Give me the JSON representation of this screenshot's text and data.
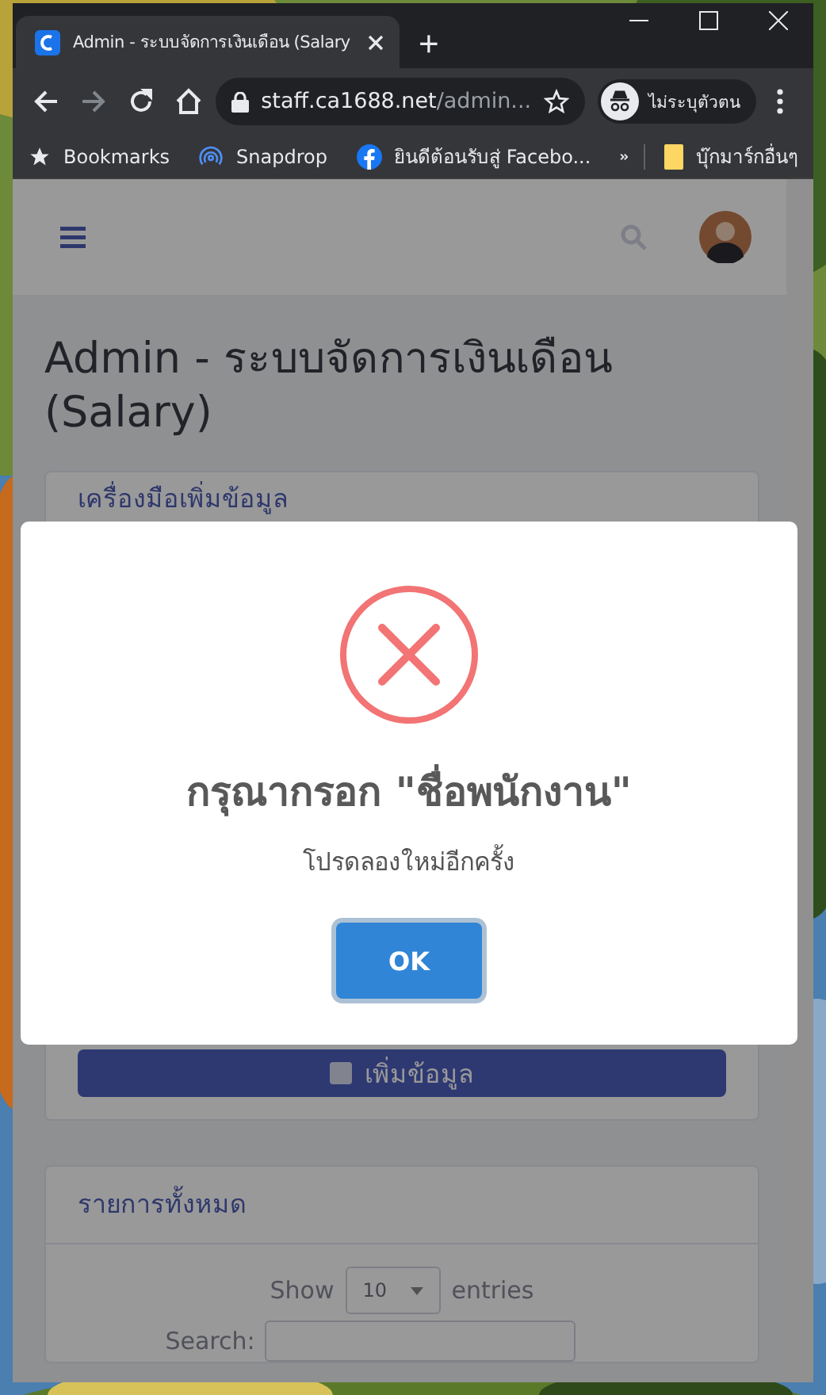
{
  "browser": {
    "tab": {
      "title": "Admin - ระบบจัดการเงินเดือน (Salary",
      "selected": true
    },
    "new_tab": "+",
    "address": {
      "host": "staff.ca1688.net",
      "path": "/admin..."
    },
    "profile": "ไม่ระบุตัวตน",
    "bookmarks": [
      {
        "label": "Bookmarks",
        "kind": "star"
      },
      {
        "label": "Snapdrop",
        "kind": "snapdrop"
      },
      {
        "label": "ยินดีต้อนรับสู่ Facebo...",
        "kind": "facebook"
      }
    ],
    "other_bookmarks": "บุ๊กมาร์กอื่นๆ"
  },
  "page": {
    "title": "Admin - ระบบจัดการเงินเดือน (Salary)",
    "tools_card": {
      "heading": "เครื่องมือเพิ่มข้อมูล",
      "button": "เพิ่มข้อมูล"
    },
    "list_card": {
      "heading": "รายการทั้งหมด",
      "show_label": "Show",
      "entries_value": "10",
      "entries_label": "entries",
      "search_label": "Search:"
    }
  },
  "dialog": {
    "kind": "error",
    "title": "กรุณากรอก \"ชื่อพนักงาน\"",
    "text": "โปรดลองใหม่อีกครั้ง",
    "confirm": "OK"
  }
}
